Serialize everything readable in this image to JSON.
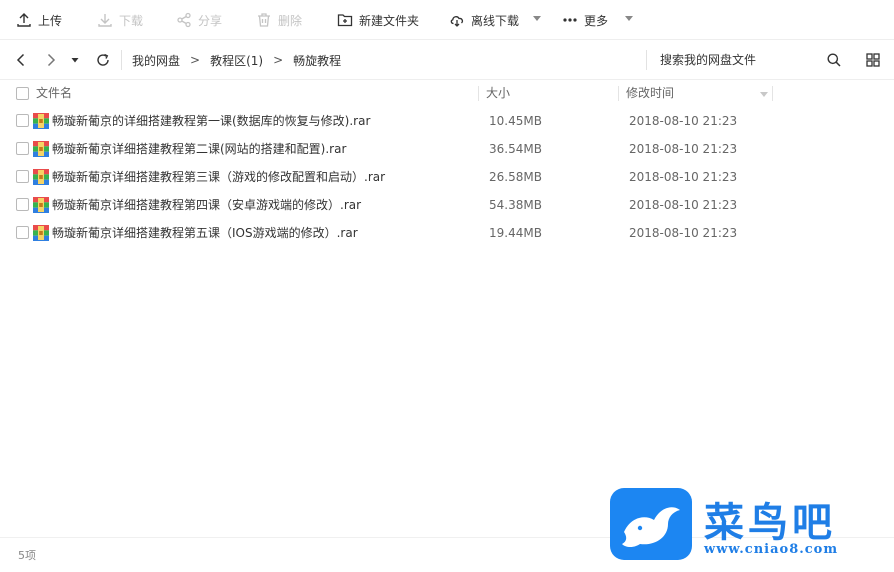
{
  "toolbar": {
    "upload": "上传",
    "download": "下载",
    "share": "分享",
    "delete": "删除",
    "new_folder": "新建文件夹",
    "offline_download": "离线下载",
    "more": "更多"
  },
  "nav": {
    "breadcrumbs": [
      "我的网盘",
      "教程区(1)",
      "畅旋教程"
    ],
    "separator": ">",
    "search_placeholder": "搜索我的网盘文件"
  },
  "table": {
    "headers": {
      "name": "文件名",
      "size": "大小",
      "modified": "修改时间"
    },
    "rows": [
      {
        "name": "畅璇新葡京的详细搭建教程第一课(数据库的恢复与修改).rar",
        "size": "10.45MB",
        "modified": "2018-08-10 21:23"
      },
      {
        "name": "畅璇新葡京详细搭建教程第二课(网站的搭建和配置).rar",
        "size": "36.54MB",
        "modified": "2018-08-10 21:23"
      },
      {
        "name": "畅璇新葡京详细搭建教程第三课（游戏的修改配置和启动）.rar",
        "size": "26.58MB",
        "modified": "2018-08-10 21:23"
      },
      {
        "name": "畅璇新葡京详细搭建教程第四课（安卓游戏端的修改）.rar",
        "size": "54.38MB",
        "modified": "2018-08-10 21:23"
      },
      {
        "name": "畅璇新葡京详细搭建教程第五课（IOS游戏端的修改）.rar",
        "size": "19.44MB",
        "modified": "2018-08-10 21:23"
      }
    ]
  },
  "status": {
    "count": "5项"
  },
  "watermark": {
    "title": "菜鸟吧",
    "url": "www.cniao8.com"
  },
  "colors": {
    "accent": "#1c86f2",
    "disabled": "#c4c4c4"
  }
}
